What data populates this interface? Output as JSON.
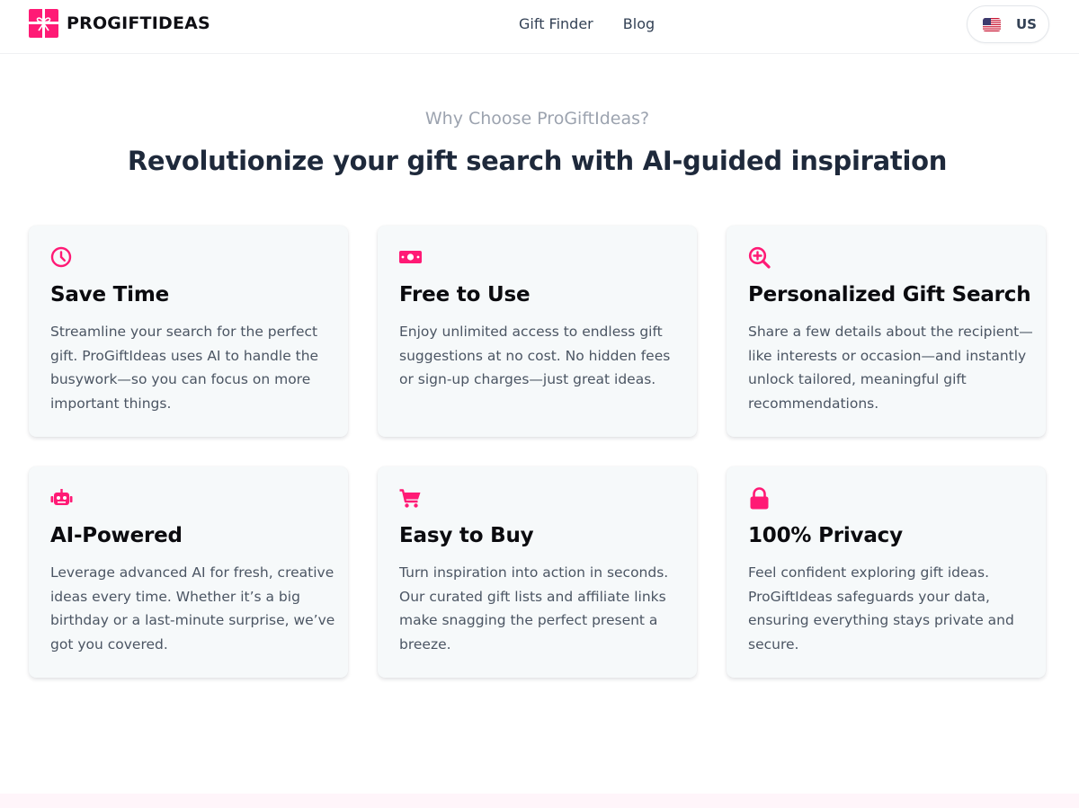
{
  "brand": {
    "name": "PROGIFTIDEAS",
    "color": "#ff1a75"
  },
  "nav": {
    "items": [
      {
        "label": "Gift Finder"
      },
      {
        "label": "Blog"
      }
    ]
  },
  "locale": {
    "label": "US",
    "flag_icon": "us-flag-icon"
  },
  "section": {
    "eyebrow": "Why Choose ProGiftIdeas?",
    "headline": "Revolutionize your gift search with AI-guided inspiration"
  },
  "features": [
    {
      "icon": "clock-icon",
      "title": "Save Time",
      "description": "Streamline your search for the perfect gift. ProGiftIdeas uses AI to handle the busywork—so you can focus on more important things."
    },
    {
      "icon": "money-bill-icon",
      "title": "Free to Use",
      "description": "Enjoy unlimited access to endless gift suggestions at no cost. No hidden fees or sign-up charges—just great ideas."
    },
    {
      "icon": "search-plus-icon",
      "title": "Personalized Gift Search",
      "description": "Share a few details about the recipient—like interests or occasion—and instantly unlock tailored, meaningful gift recommendations."
    },
    {
      "icon": "robot-icon",
      "title": "AI-Powered",
      "description": "Leverage advanced AI for fresh, creative ideas every time. Whether it’s a big birthday or a last-minute surprise, we’ve got you covered."
    },
    {
      "icon": "shopping-cart-icon",
      "title": "Easy to Buy",
      "description": "Turn inspiration into action in seconds. Our curated gift lists and affiliate links make snagging the perfect present a breeze."
    },
    {
      "icon": "lock-icon",
      "title": "100% Privacy",
      "description": "Feel confident exploring gift ideas. ProGiftIdeas safeguards your data, ensuring everything stays private and secure."
    }
  ]
}
